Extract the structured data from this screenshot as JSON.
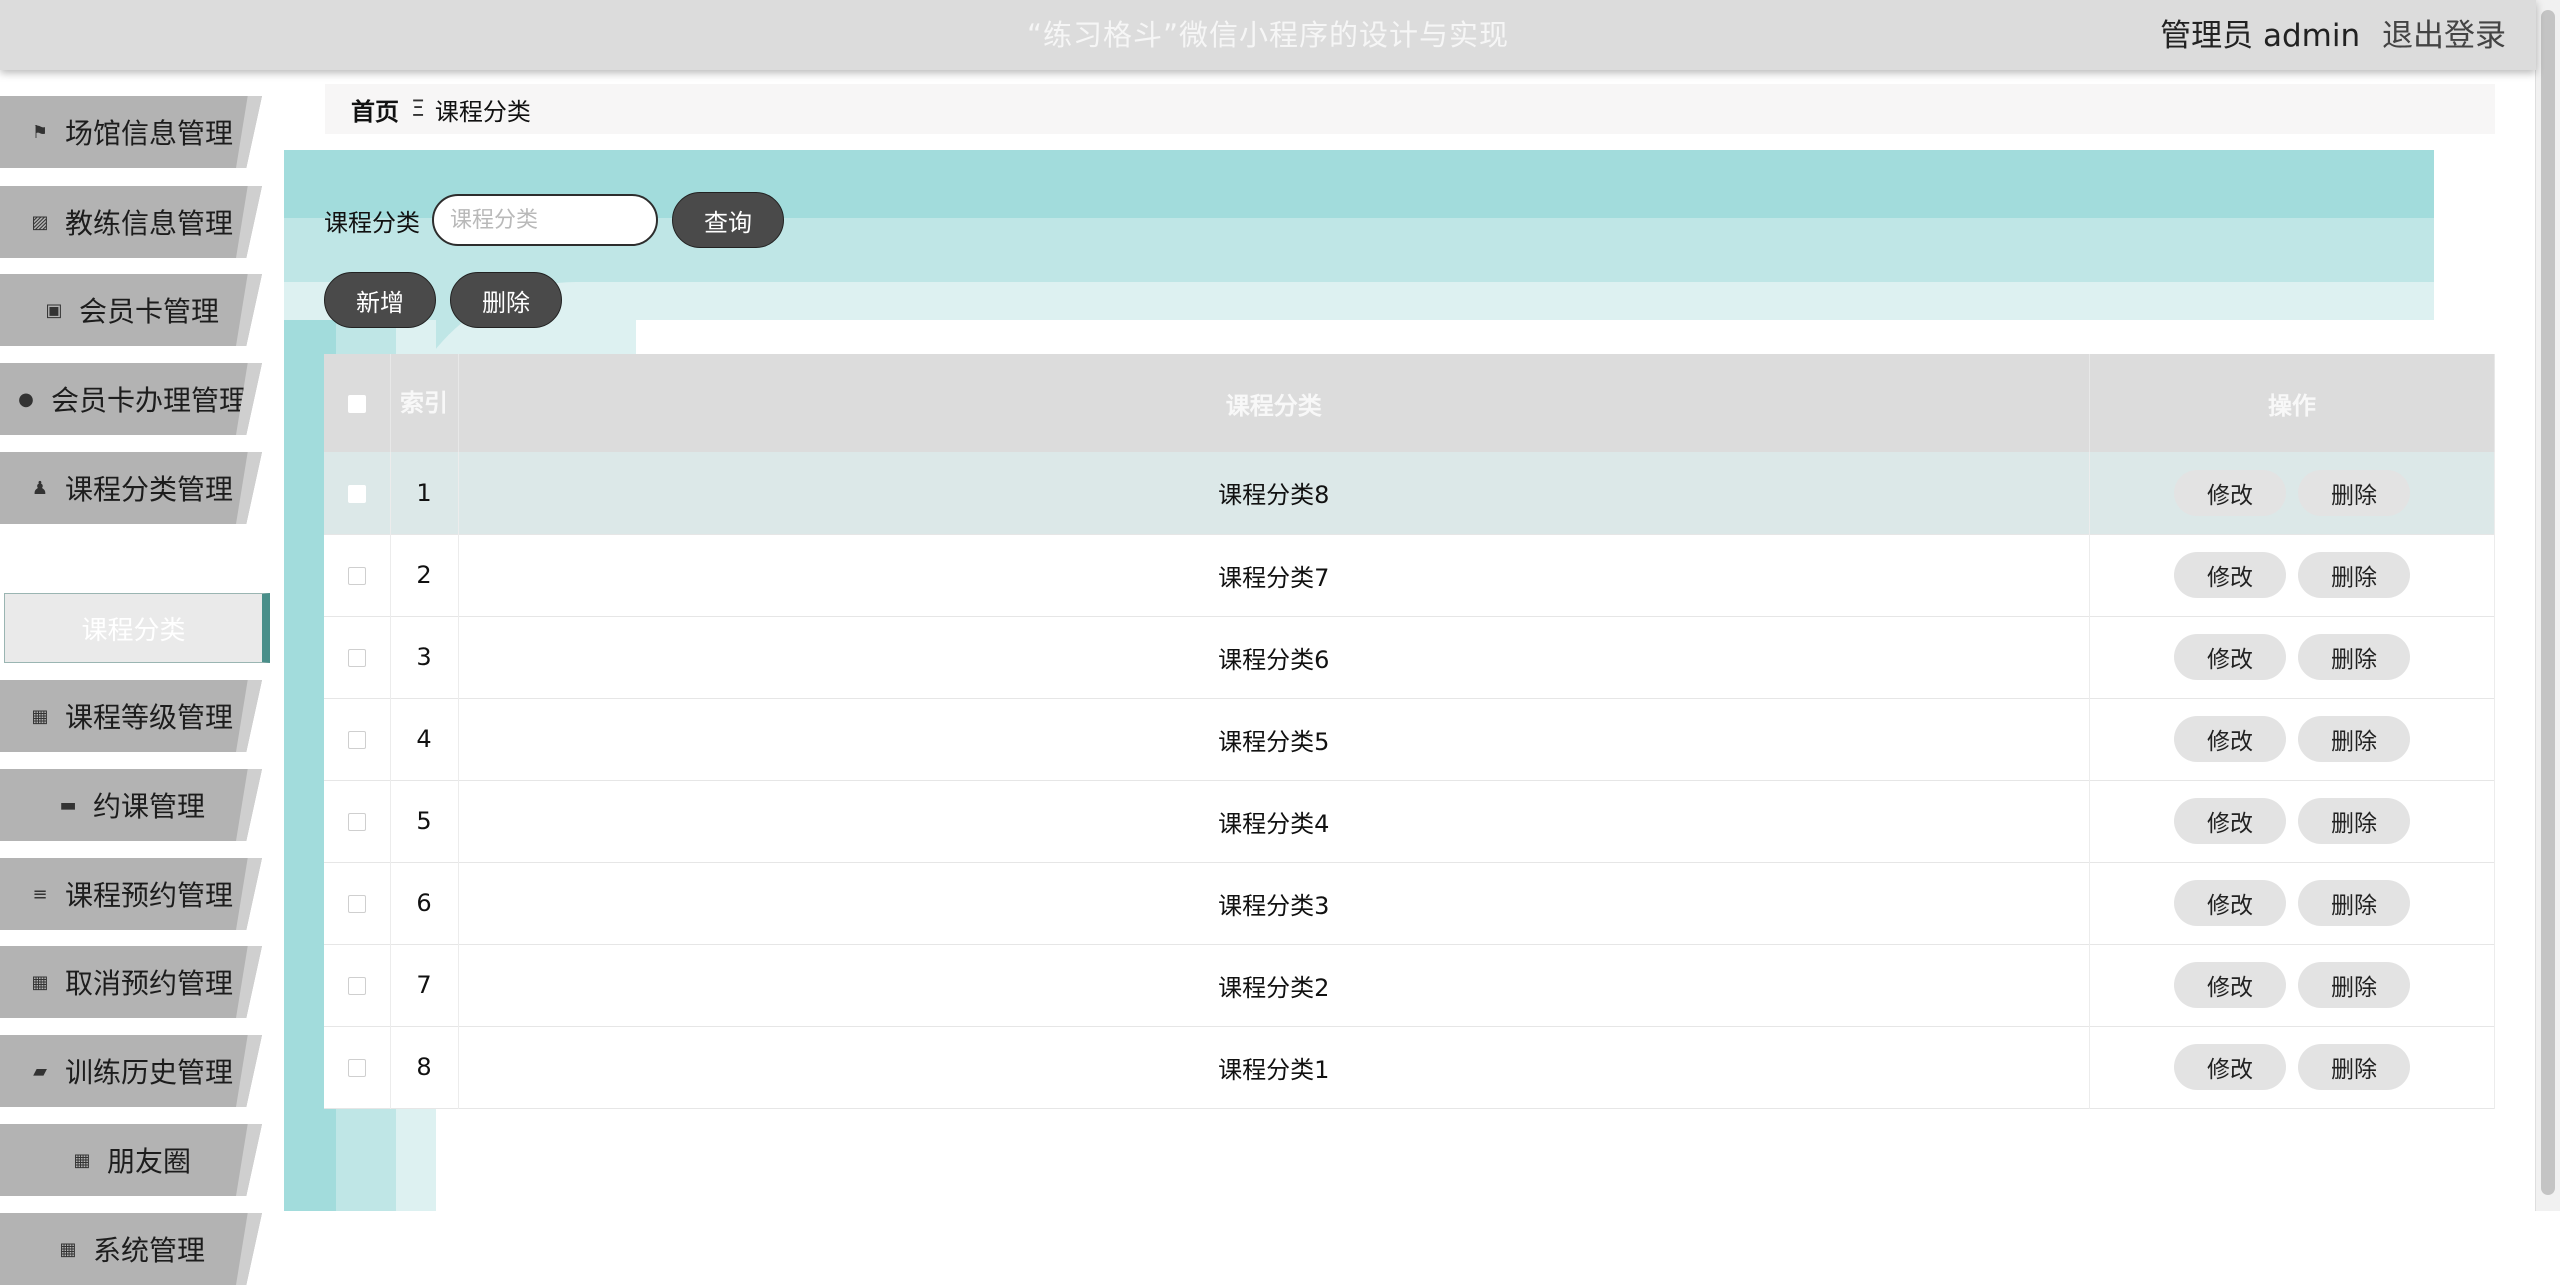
{
  "header": {
    "title": "“练习格斗”微信小程序的设计与实现",
    "user_label": "管理员 admin",
    "logout_label": "退出登录"
  },
  "sidebar": {
    "items": [
      {
        "label": "场馆信息管理",
        "icon": "flag-icon"
      },
      {
        "label": "教练信息管理",
        "icon": "chart-icon"
      },
      {
        "label": "会员卡管理",
        "icon": "clipboard-icon"
      },
      {
        "label": "会员卡办理管理",
        "icon": "bulb-icon"
      },
      {
        "label": "课程分类管理",
        "icon": "user-icon"
      },
      {
        "label": "课程等级管理",
        "icon": "grid-icon"
      },
      {
        "label": "约课管理",
        "icon": "briefcase-icon"
      },
      {
        "label": "课程预约管理",
        "icon": "list-icon"
      },
      {
        "label": "取消预约管理",
        "icon": "grid-icon"
      },
      {
        "label": "训练历史管理",
        "icon": "wallet-icon"
      },
      {
        "label": "朋友圈",
        "icon": "grid-icon"
      },
      {
        "label": "系统管理",
        "icon": "grid-icon"
      }
    ],
    "active_sub": "课程分类"
  },
  "breadcrumb": {
    "home": "首页",
    "separator": "Ξ",
    "current": "课程分类"
  },
  "search": {
    "label": "课程分类",
    "placeholder": "课程分类",
    "button": "查询"
  },
  "actions": {
    "add": "新增",
    "delete": "删除"
  },
  "table": {
    "headers": {
      "index": "索引",
      "category": "课程分类",
      "ops": "操作"
    },
    "rows": [
      {
        "index": "1",
        "category": "课程分类8"
      },
      {
        "index": "2",
        "category": "课程分类7"
      },
      {
        "index": "3",
        "category": "课程分类6"
      },
      {
        "index": "4",
        "category": "课程分类5"
      },
      {
        "index": "5",
        "category": "课程分类4"
      },
      {
        "index": "6",
        "category": "课程分类3"
      },
      {
        "index": "7",
        "category": "课程分类2"
      },
      {
        "index": "8",
        "category": "课程分类1"
      }
    ],
    "edit_label": "修改",
    "delete_label": "删除"
  },
  "colors": {
    "topbar": "#dcdcdc",
    "menu": "#b3b3b3",
    "accent_teal": "#a2dcdc",
    "button_dark": "#4a4a4a"
  }
}
